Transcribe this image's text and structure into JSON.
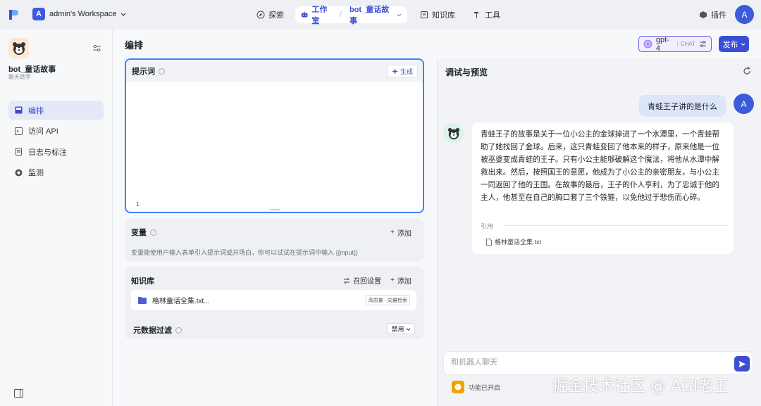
{
  "workspace": {
    "avatar": "A",
    "name": "admin's Workspace"
  },
  "nav": {
    "explore": "探索",
    "studio": "工作室",
    "bot": "bot_童话故事",
    "knowledge": "知识库",
    "tools": "工具",
    "plugins": "插件"
  },
  "user": {
    "avatar": "A"
  },
  "sidebar": {
    "bot_name": "bot_童话故事",
    "bot_desc": "聊天助手",
    "items": [
      {
        "label": "编排",
        "icon": "layout-icon",
        "active": true
      },
      {
        "label": "访问 API",
        "icon": "terminal-icon",
        "active": false
      },
      {
        "label": "日志与标注",
        "icon": "doc-icon",
        "active": false
      },
      {
        "label": "监测",
        "icon": "monitor-icon",
        "active": false
      }
    ]
  },
  "header": {
    "title": "编排",
    "model": "gpt-4",
    "model_tag": "CHAT",
    "publish": "发布"
  },
  "prompt": {
    "title": "提示词",
    "generate": "生成",
    "line": "1"
  },
  "variables": {
    "title": "变量",
    "add": "添加",
    "desc": "变量能使用户输入表单引入提示词或开场白，你可以试试在提示词中输入 {{input}}"
  },
  "knowledge": {
    "title": "知识库",
    "recall": "召回设置",
    "add": "添加",
    "item": "格林童话全集.txt...",
    "item_tag": "高质量 · 向量检索"
  },
  "metadata": {
    "title": "元数据过滤",
    "select": "禁用"
  },
  "debug": {
    "title": "调试与预览",
    "user_message": "青蛙王子讲的是什么",
    "bot_message": "青蛙王子的故事是关于一位小公主的金球掉进了一个水潭里，一个青蛙帮助了她找回了金球。后来，这只青蛙变回了他本来的样子，原来他是一位被巫婆变成青蛙的王子。只有小公主能够破解这个魔法，将他从水潭中解救出来。然后，按照国王的意愿，他成为了小公主的亲密朋友，与小公主一同返回了他的王国。在故事的最后，王子的仆人亨利，为了忠诚于他的主人，他甚至在自己的胸口套了三个铁箍，以免他过于悲伤而心碎。",
    "cite_label": "引用",
    "cite_file": "格林童话全集.txt",
    "input_placeholder": "和机器人聊天",
    "feature": "功能已开启"
  },
  "watermark": "掘金技术社区 @ AGI老王",
  "colors": {
    "accent": "#3b4fd6",
    "highlight": "#3b82f6"
  }
}
